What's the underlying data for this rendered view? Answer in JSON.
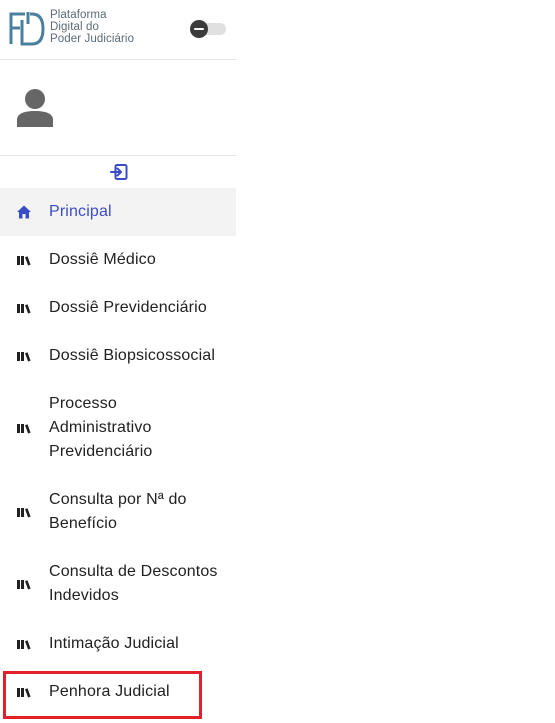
{
  "brand": {
    "line1": "Plataforma",
    "line2": "Digital do",
    "line3": "Poder Judiciário",
    "logo_color": "#4a7fa0",
    "text_color": "#5d6a75"
  },
  "theme_toggle": {
    "state": "off",
    "icon": "minus-icon"
  },
  "user": {
    "icon": "user-avatar-icon"
  },
  "collapse": {
    "icon": "sign-in-icon"
  },
  "colors": {
    "active_text": "#3a4cc8",
    "active_bg": "#f3f3f3",
    "highlight_border": "#e0202a"
  },
  "nav": {
    "items": [
      {
        "label": "Principal",
        "icon": "home-icon",
        "active": true
      },
      {
        "label": "Dossiê Médico",
        "icon": "books-icon"
      },
      {
        "label": "Dossiê Previdenciário",
        "icon": "books-icon"
      },
      {
        "label": "Dossiê Biopsicossocial",
        "icon": "books-icon"
      },
      {
        "label": "Processo Administrativo Previdenciário",
        "icon": "books-icon"
      },
      {
        "label": "Consulta por Nª do Benefício",
        "icon": "books-icon"
      },
      {
        "label": "Consulta de Descontos Indevidos",
        "icon": "books-icon"
      },
      {
        "label": "Intimação Judicial",
        "icon": "books-icon"
      },
      {
        "label": "Penhora Judicial",
        "icon": "books-icon",
        "highlighted": true
      }
    ]
  }
}
